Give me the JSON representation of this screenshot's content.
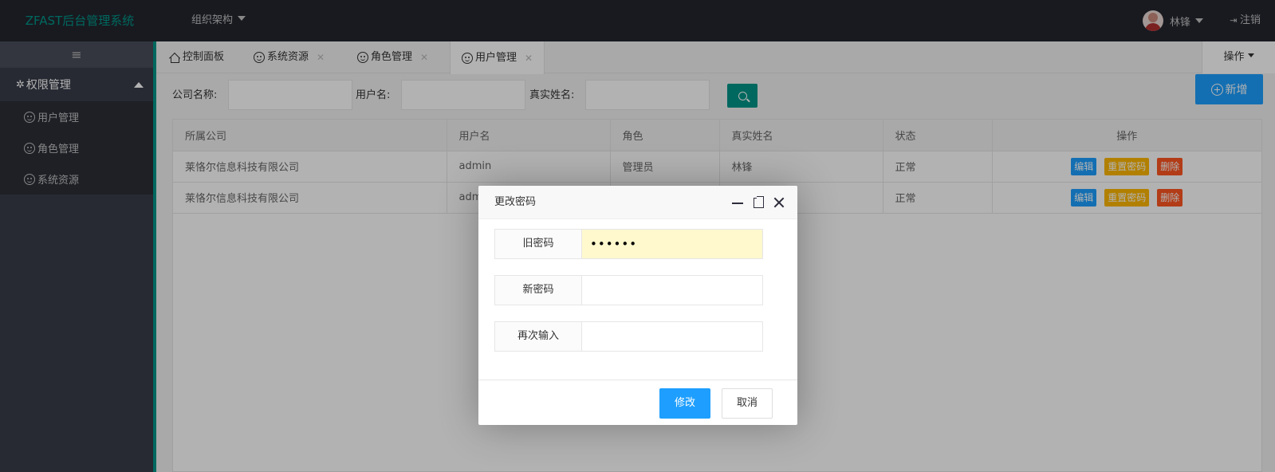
{
  "header": {
    "logo": "ZFAST后台管理系统",
    "org_menu": "组织架构",
    "user_name": "林锋",
    "logout": "注销"
  },
  "sidebar": {
    "toggle_icon": "menu-icon",
    "group_label": "权限管理",
    "items": [
      {
        "label": "用户管理",
        "icon": "smile-icon"
      },
      {
        "label": "角色管理",
        "icon": "smile-icon"
      },
      {
        "label": "系统资源",
        "icon": "smile-icon"
      }
    ]
  },
  "tabs": [
    {
      "label": "控制面板",
      "icon": "home-icon"
    },
    {
      "label": "系统资源",
      "icon": "smile-icon"
    },
    {
      "label": "角色管理",
      "icon": "smile-icon"
    },
    {
      "label": "用户管理",
      "icon": "smile-icon",
      "active": true
    }
  ],
  "tab_ops": "操作",
  "search": {
    "company_label": "公司名称:",
    "username_label": "用户名:",
    "realname_label": "真实姓名:",
    "add_label": "新增"
  },
  "table": {
    "columns": [
      "所属公司",
      "用户名",
      "角色",
      "真实姓名",
      "状态",
      "操作"
    ],
    "rows": [
      {
        "company": "莱恪尔信息科技有限公司",
        "username": "admin",
        "role": "管理员",
        "realname": "林锋",
        "status": "正常"
      },
      {
        "company": "莱恪尔信息科技有限公司",
        "username": "admin",
        "role": "",
        "realname": "",
        "status": "正常"
      }
    ],
    "actions": {
      "edit": "编辑",
      "reset": "重置密码",
      "delete": "删除"
    }
  },
  "dialog": {
    "title": "更改密码",
    "fields": [
      {
        "label": "旧密码",
        "value": "••••••"
      },
      {
        "label": "新密码",
        "value": ""
      },
      {
        "label": "再次输入",
        "value": ""
      }
    ],
    "ok": "修改",
    "cancel": "取消"
  },
  "colors": {
    "header_bg": "#23262e",
    "sidebar_bg": "#393d49",
    "accent": "#009688",
    "primary": "#1e9fff",
    "warn": "#ffb800",
    "danger": "#ff5722"
  }
}
